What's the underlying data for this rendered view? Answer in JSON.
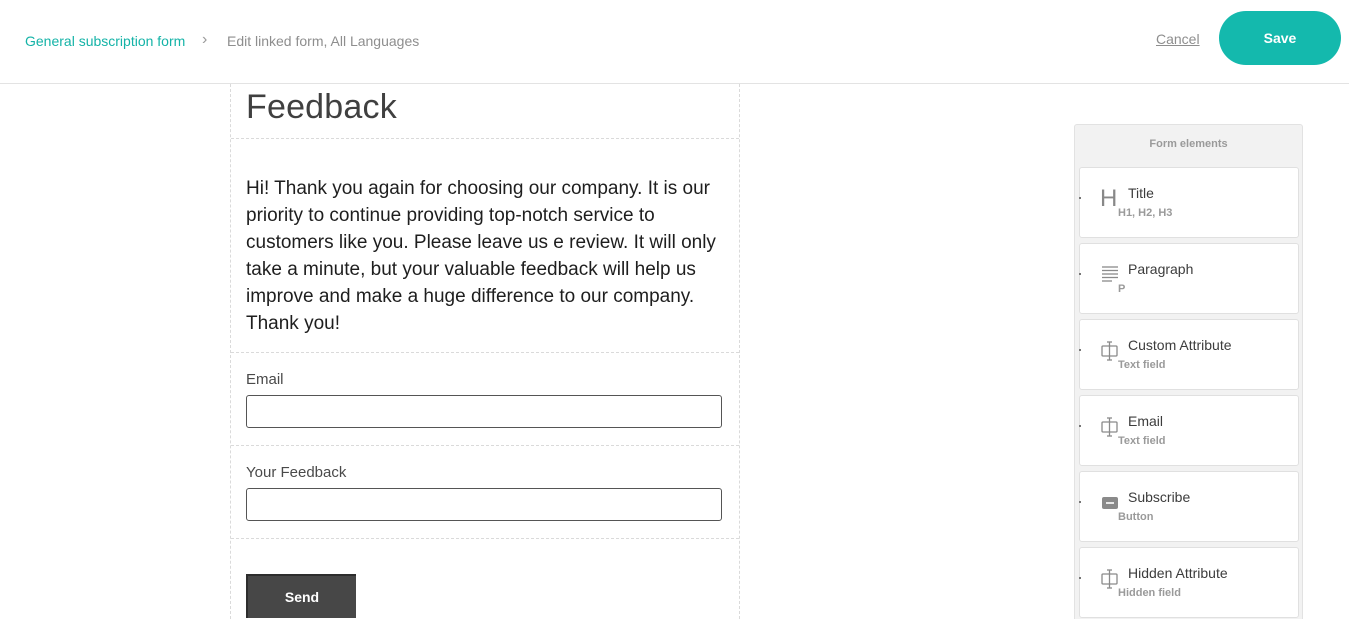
{
  "header": {
    "breadcrumb_link": "General subscription form",
    "breadcrumb_separator": "›",
    "breadcrumb_current": "Edit linked form, All Languages",
    "cancel_label": "Cancel",
    "save_label": "Save"
  },
  "colors": {
    "accent": "#14b9ad",
    "button_dark": "#474747"
  },
  "form": {
    "title": "Feedback",
    "paragraph": "Hi! Thank you again for choosing our company. It is our priority to continue providing top-notch service to customers like you. Please leave us e review. It will only take a minute, but your valuable feedback will help us improve and make a huge difference to our company. Thank you!",
    "fields": [
      {
        "label": "Email",
        "value": ""
      },
      {
        "label": "Your Feedback",
        "value": ""
      }
    ],
    "submit_label": "Send"
  },
  "panel": {
    "title": "Form elements",
    "items": [
      {
        "label": "Title",
        "sub": "H1, H2, H3",
        "icon": "heading-icon"
      },
      {
        "label": "Paragraph",
        "sub": "P",
        "icon": "paragraph-icon"
      },
      {
        "label": "Custom Attribute",
        "sub": "Text field",
        "icon": "text-field-icon"
      },
      {
        "label": "Email",
        "sub": "Text field",
        "icon": "text-field-icon"
      },
      {
        "label": "Subscribe",
        "sub": "Button",
        "icon": "button-icon"
      },
      {
        "label": "Hidden Attribute",
        "sub": "Hidden field",
        "icon": "text-field-icon"
      }
    ]
  }
}
